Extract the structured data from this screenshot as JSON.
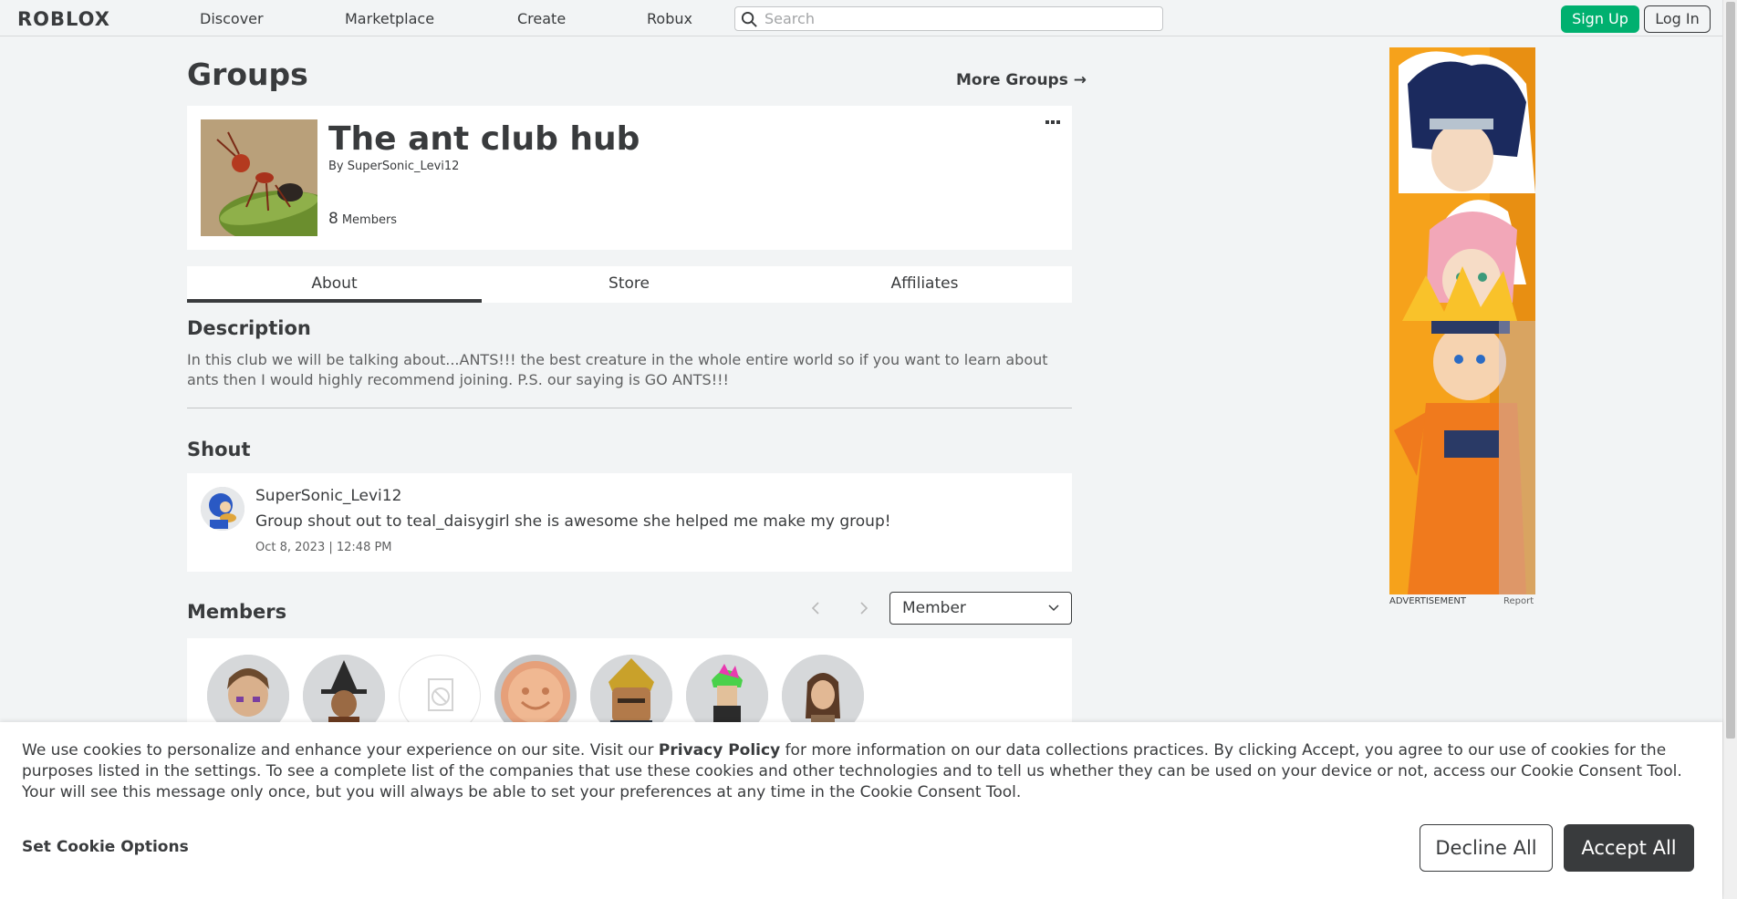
{
  "header": {
    "logo": "ROBLOX",
    "nav": [
      "Discover",
      "Marketplace",
      "Create",
      "Robux"
    ],
    "search_placeholder": "Search",
    "signup_label": "Sign Up",
    "login_label": "Log In"
  },
  "page": {
    "title": "Groups",
    "more_groups": "More Groups →"
  },
  "group": {
    "name": "The ant club hub",
    "by_prefix": "By",
    "owner": "SuperSonic_Levi12",
    "member_count": "8",
    "member_label": "Members",
    "more_icon": "more-horizontal-icon"
  },
  "tabs": [
    "About",
    "Store",
    "Affiliates"
  ],
  "description": {
    "heading": "Description",
    "text": "In this club we will be talking about...ANTS!!! the best creature in the whole entire world so if you want to learn about ants then I would highly recommend joining. P.S. our saying is GO ANTS!!!"
  },
  "shout": {
    "heading": "Shout",
    "user": "SuperSonic_Levi12",
    "text": "Group shout out to teal_daisygirl she is awesome she helped me make my group!",
    "date": "Oct 8, 2023 | 12:48 PM"
  },
  "members": {
    "heading": "Members",
    "role_selected": "Member",
    "prev_icon": "chevron-left-icon",
    "next_icon": "chevron-right-icon"
  },
  "ad": {
    "label": "ADVERTISEMENT",
    "report": "Report"
  },
  "cookie": {
    "text_before": "We use cookies to personalize and enhance your experience on our site. Visit our ",
    "policy_link": "Privacy Policy",
    "text_after": " for more information on our data collections practices. By clicking Accept, you agree to our use of cookies for the purposes listed in the settings. To see a complete list of the companies that use these cookies and other technologies and to tell us whether they can be used on your device or not, access our Cookie Consent Tool. Your will see this message only once, but you will always be able to set your preferences at any time in the Cookie Consent Tool.",
    "options_label": "Set Cookie Options",
    "decline_label": "Decline All",
    "accept_label": "Accept All"
  },
  "colors": {
    "signup_green": "#00b06f",
    "accept_dark": "#393b3d",
    "page_bg": "#f2f4f5"
  }
}
